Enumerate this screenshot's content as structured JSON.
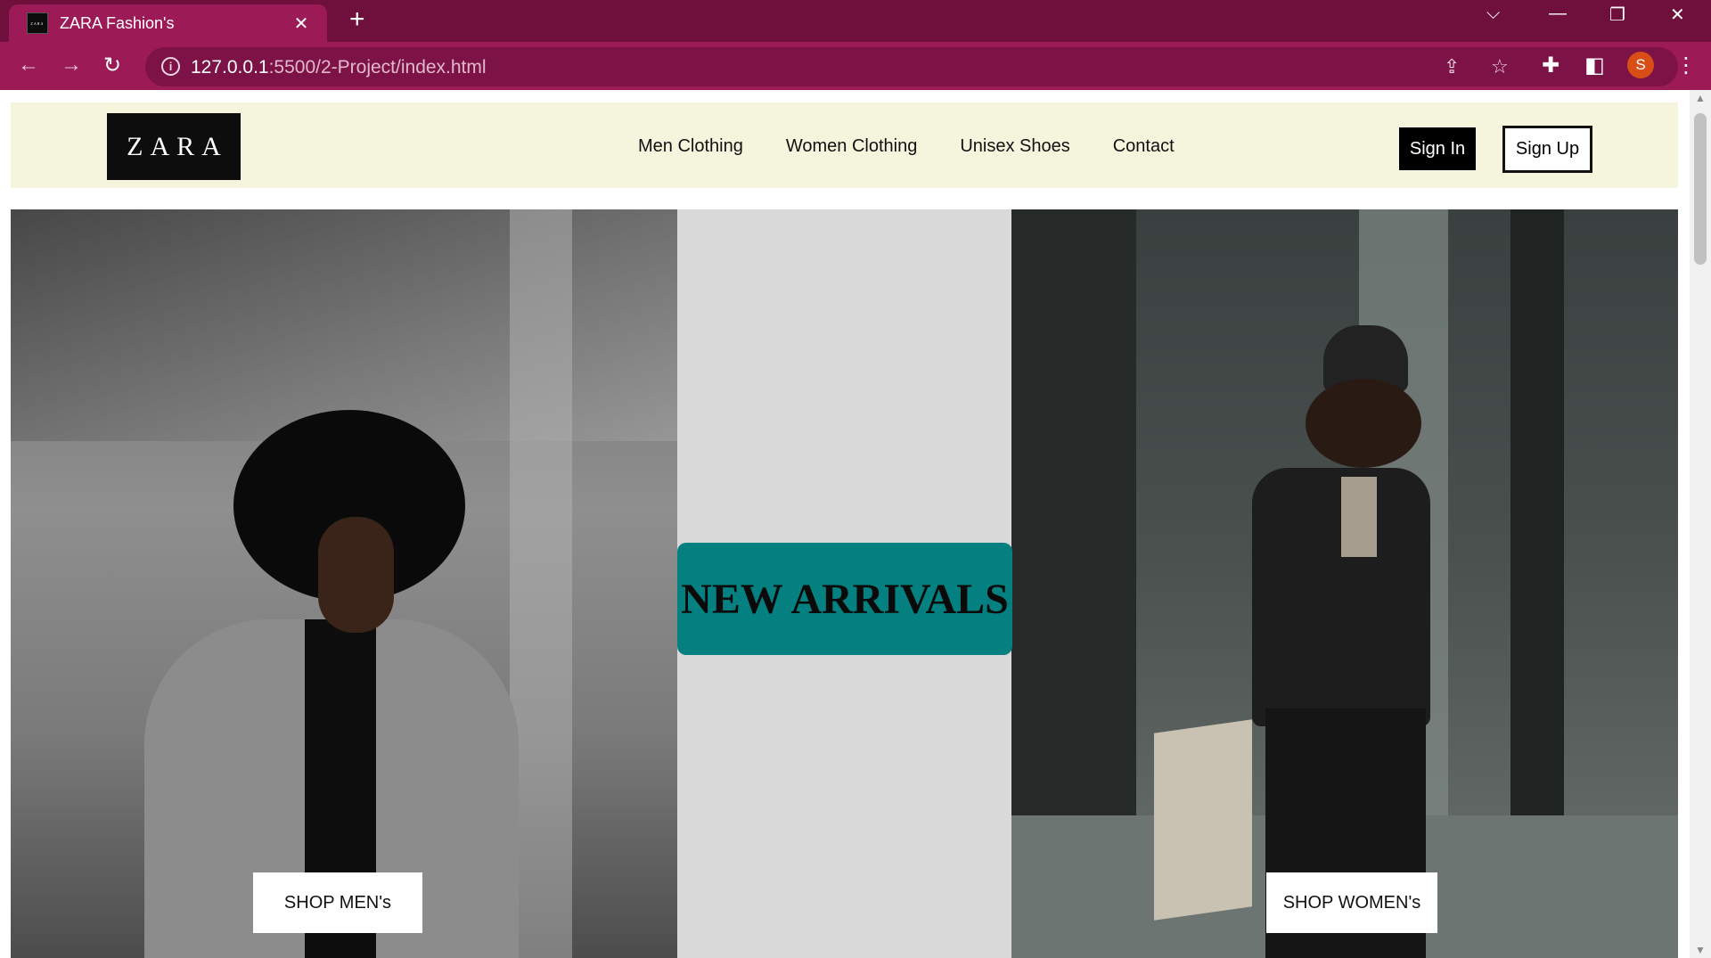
{
  "browser": {
    "tab_title": "ZARA Fashion's",
    "favicon_text": "ZARA",
    "new_tab_icon": "plus-icon",
    "url_host": "127.0.0.1",
    "url_rest": ":5500/2-Project/index.html",
    "profile_initial": "S",
    "accent_color": "#9c1a55"
  },
  "header": {
    "logo": "ZARA",
    "nav": [
      "Men Clothing",
      "Women Clothing",
      "Unisex Shoes",
      "Contact"
    ],
    "sign_in": "Sign In",
    "sign_up": "Sign Up"
  },
  "hero": {
    "badge": "NEW ARRIVALS",
    "badge_color": "#058080",
    "shop_men": "SHOP MEN's",
    "shop_women": "SHOP WOMEN's"
  }
}
